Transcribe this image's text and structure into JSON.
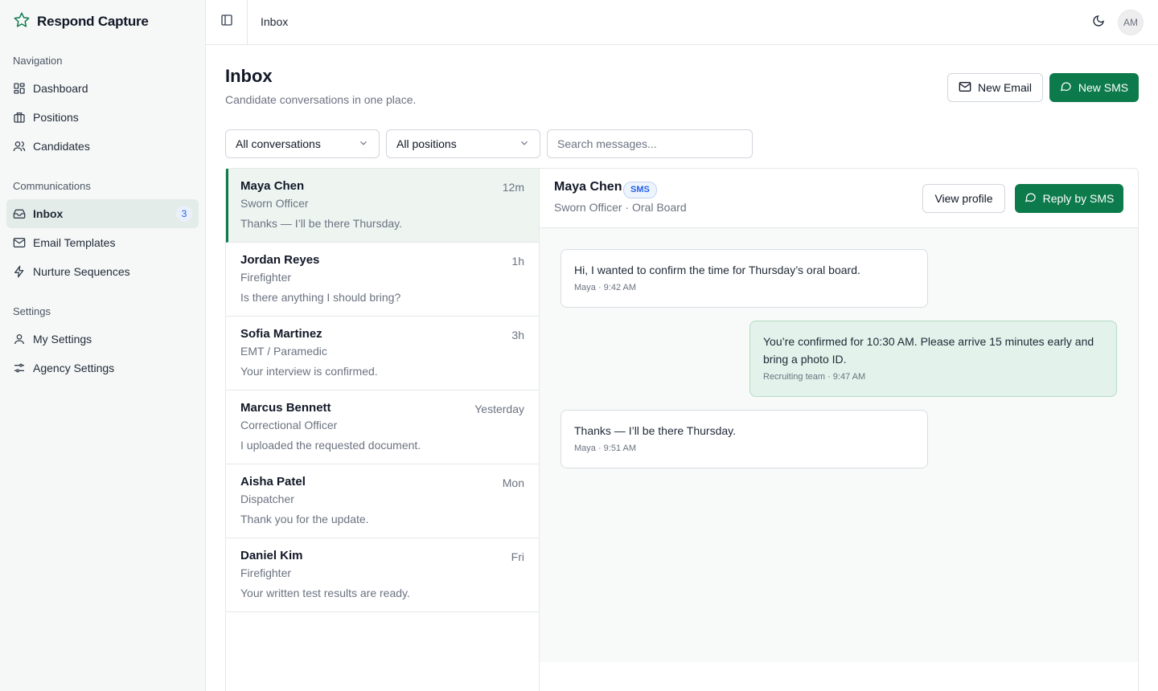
{
  "app": {
    "name": "Respond Capture"
  },
  "sidebar": {
    "groups": [
      {
        "label": "Navigation",
        "items": [
          {
            "label": "Dashboard"
          },
          {
            "label": "Positions"
          },
          {
            "label": "Candidates"
          }
        ]
      },
      {
        "label": "Communications",
        "items": [
          {
            "label": "Inbox",
            "badge": "3"
          },
          {
            "label": "Email Templates"
          },
          {
            "label": "Nurture Sequences"
          }
        ]
      },
      {
        "label": "Settings",
        "items": [
          {
            "label": "My Settings"
          },
          {
            "label": "Agency Settings"
          }
        ]
      }
    ]
  },
  "topbar": {
    "breadcrumb": "Inbox",
    "avatar_initials": "AM"
  },
  "page": {
    "title": "Inbox",
    "subtitle": "Candidate conversations in one place.",
    "new_email_label": "New Email",
    "new_sms_label": "New SMS"
  },
  "filters": {
    "conversation_filter": "All conversations",
    "position_filter": "All positions",
    "search_placeholder": "Search messages..."
  },
  "conversations": [
    {
      "name": "Maya Chen",
      "role": "Sworn Officer",
      "preview": "Thanks — I’ll be there Thursday.",
      "time": "12m"
    },
    {
      "name": "Jordan Reyes",
      "role": "Firefighter",
      "preview": "Is there anything I should bring?",
      "time": "1h"
    },
    {
      "name": "Sofia Martinez",
      "role": "EMT / Paramedic",
      "preview": "Your interview is confirmed.",
      "time": "3h"
    },
    {
      "name": "Marcus Bennett",
      "role": "Correctional Officer",
      "preview": "I uploaded the requested document.",
      "time": "Yesterday"
    },
    {
      "name": "Aisha Patel",
      "role": "Dispatcher",
      "preview": "Thank you for the update.",
      "time": "Mon"
    },
    {
      "name": "Daniel Kim",
      "role": "Firefighter",
      "preview": "Your written test results are ready.",
      "time": "Fri"
    }
  ],
  "thread": {
    "name": "Maya Chen",
    "channel": "SMS",
    "subtitle": "Sworn Officer · Oral Board",
    "view_profile_label": "View profile",
    "reply_label": "Reply by SMS",
    "messages": [
      {
        "direction": "in",
        "text": "Hi, I wanted to confirm the time for Thursday’s oral board.",
        "meta": "Maya · 9:42 AM"
      },
      {
        "direction": "out",
        "text": "You’re confirmed for 10:30 AM. Please arrive 15 minutes early and bring a photo ID.",
        "meta": "Recruiting team · 9:47 AM"
      },
      {
        "direction": "in",
        "text": "Thanks — I’ll be there Thursday.",
        "meta": "Maya · 9:51 AM"
      }
    ]
  },
  "colors": {
    "brand": "#0c7a4a",
    "badge_blue": "#2563eb"
  }
}
